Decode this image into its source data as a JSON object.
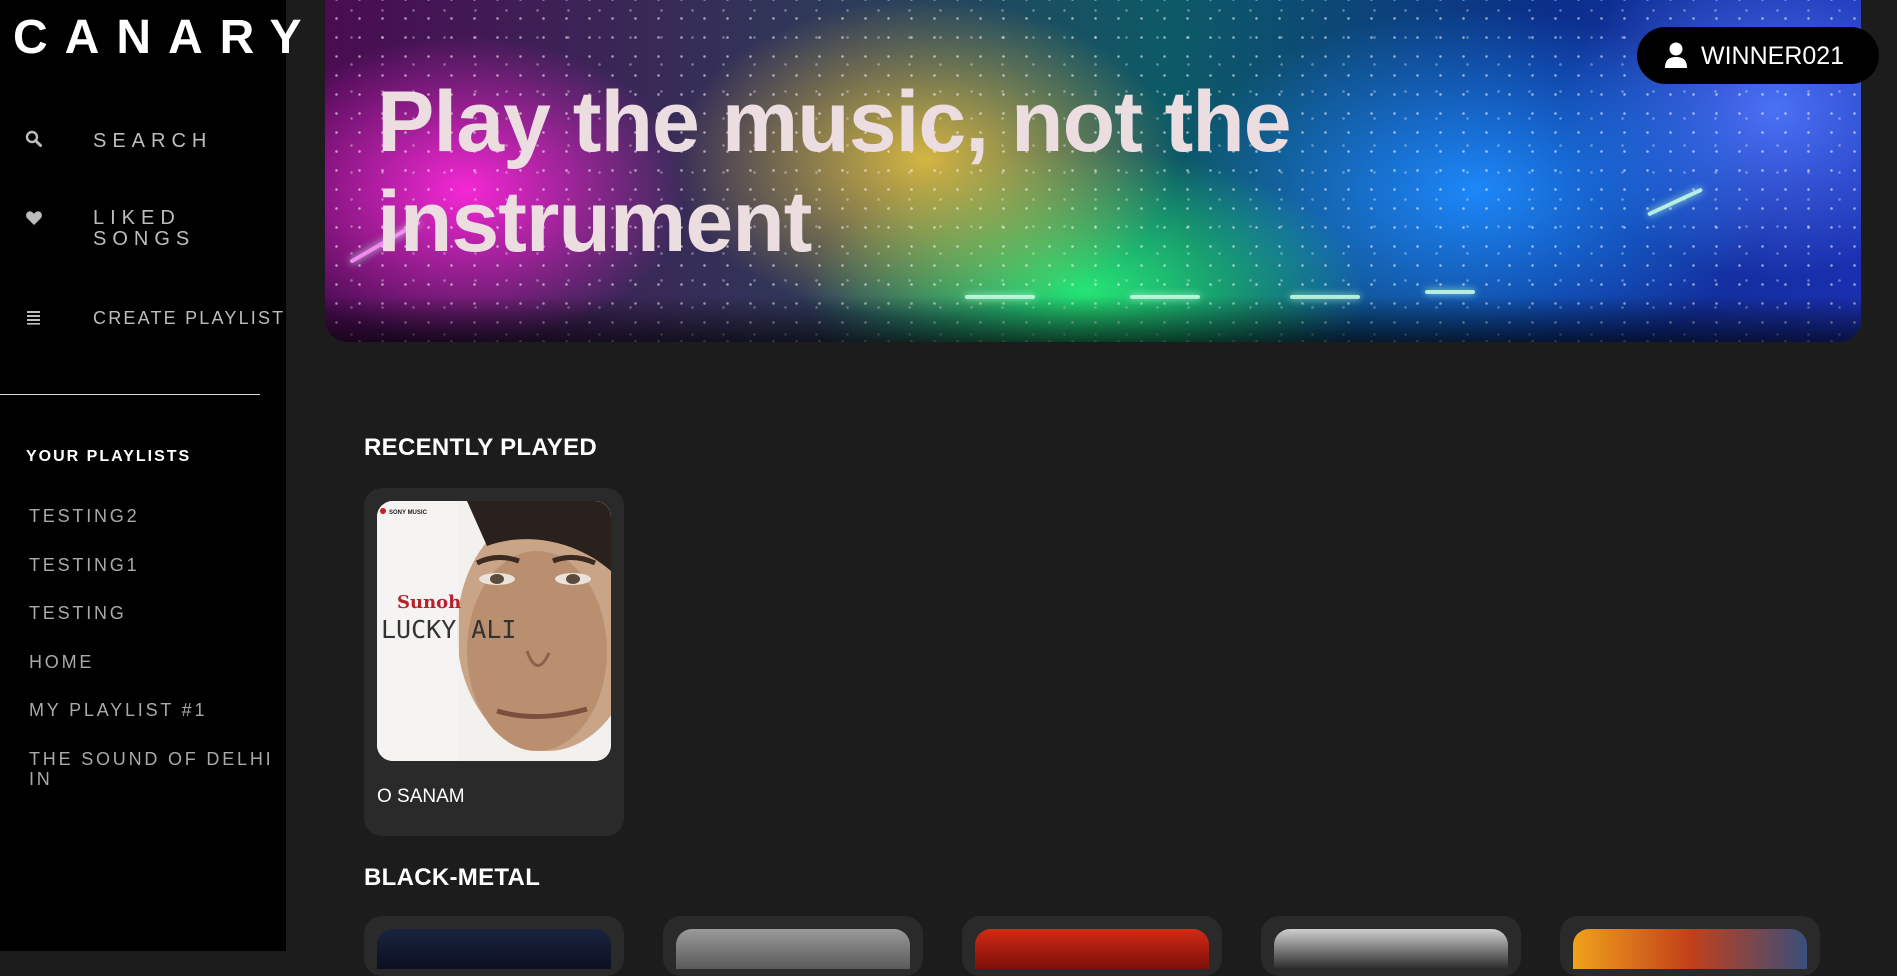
{
  "app": {
    "logo": "CANARY"
  },
  "sidebar": {
    "nav": [
      {
        "label": "SEARCH",
        "icon": "search-icon"
      },
      {
        "label": "LIKED SONGS",
        "icon": "heart-icon"
      },
      {
        "label": "CREATE PLAYLIST",
        "icon": "list-icon"
      }
    ],
    "playlists_title": "YOUR PLAYLISTS",
    "playlists": [
      "TESTING2",
      "TESTING1",
      "TESTING",
      "HOME",
      "MY PLAYLIST #1",
      "THE SOUND OF DELHI IN"
    ]
  },
  "hero": {
    "title": "Play the music, not the instrument"
  },
  "user": {
    "name": "WINNER021",
    "icon": "user-icon"
  },
  "recently_played": {
    "title": "RECENTLY PLAYED",
    "items": [
      {
        "label": "O SANAM",
        "cover_text": {
          "label_top": "SONY MUSIC",
          "title": "Sunoh",
          "artist": "LUCKY ALI"
        }
      }
    ]
  },
  "black_metal": {
    "title": "BLACK-METAL"
  },
  "colors": {
    "sidebar_bg": "#000000",
    "main_bg": "#1c1c1c",
    "card_bg": "#2a2a2a",
    "accent_text": "#ecdde0"
  }
}
